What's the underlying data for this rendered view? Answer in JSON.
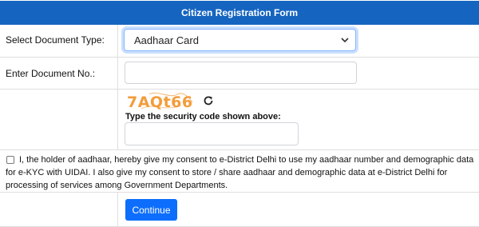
{
  "form": {
    "title": "Citizen Registration Form"
  },
  "document_type": {
    "label": "Select Document Type:",
    "selected": "Aadhaar Card"
  },
  "document_no": {
    "label": "Enter Document No.:",
    "value": ""
  },
  "captcha": {
    "code": "7AQt66",
    "hint": "Type the security code shown above:",
    "input_value": "",
    "refresh_icon": "refresh-icon"
  },
  "consent": {
    "text": "I, the holder of aadhaar, hereby give my consent to e-District Delhi to use my aadhaar number and demographic data for e-KYC with UIDAI. I also give my consent to store / share aadhaar and demographic data at e-District Delhi for processing of services among Government Departments.",
    "checked": false
  },
  "actions": {
    "continue_label": "Continue"
  },
  "colors": {
    "header_bg": "#1565c0",
    "button_bg": "#0d6efd",
    "captcha_text": "#f39c3a"
  }
}
